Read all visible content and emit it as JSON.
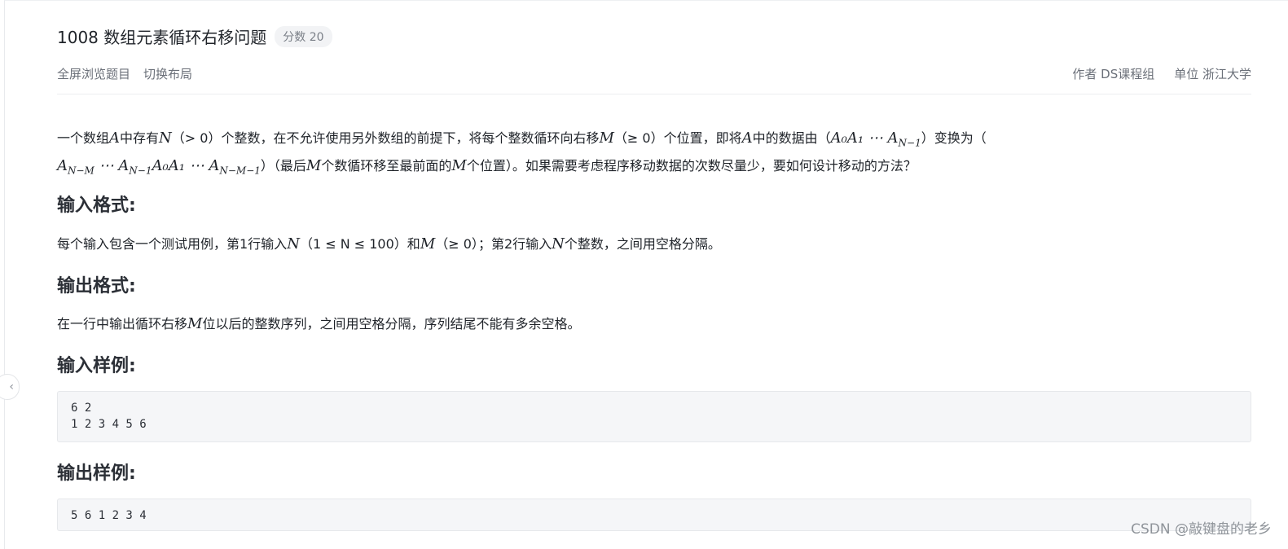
{
  "problem": {
    "title": "1008 数组元素循环右移问题",
    "score": "分数 20",
    "actions": [
      "全屏浏览题目",
      "切换布局"
    ],
    "author": "作者 DS课程组",
    "unit": "单位 浙江大学"
  },
  "description": {
    "line1_a": "一个数组",
    "var_A": "A",
    "line1_b": "中存有",
    "var_N": "N",
    "cond_N": "（> 0）",
    "line1_c": "个整数，在不允许使用另外数组的前提下，将每个整数循环向右移",
    "var_M": "M",
    "cond_M": "（≥ 0）",
    "line1_d": "个位置，即将",
    "line1_e": "中的数据由（",
    "seq_from": "A₀A₁ ⋯ A",
    "seq_from_sub": "N−1",
    "line1_f": "）变换为（",
    "seq_to_a": "A",
    "seq_to_a_sub": "N−M",
    "seq_to_b": " ⋯ A",
    "seq_to_b_sub": "N−1",
    "seq_to_c": "A₀A₁ ⋯ A",
    "seq_to_c_sub": "N−M−1",
    "line2_a": "）（最后",
    "line2_b": "个数循环移至最前面的",
    "line2_c": "个位置）。如果需要考虑程序移动数据的次数尽量少，要如何设计移动的方法？"
  },
  "input_format": {
    "heading": "输入格式:",
    "a": "每个输入包含一个测试用例，第1行输入",
    "range": "（1 ≤ N ≤ 100）",
    "b": "和",
    "mcond": "（≥ 0）",
    "c": "；第2行输入",
    "d": "个整数，之间用空格分隔。"
  },
  "output_format": {
    "heading": "输出格式:",
    "a": "在一行中输出循环右移",
    "b": "位以后的整数序列，之间用空格分隔，序列结尾不能有多余空格。"
  },
  "sample_input": {
    "heading": "输入样例:",
    "code": "6 2\n1 2 3 4 5 6"
  },
  "sample_output": {
    "heading": "输出样例:",
    "code": "5 6 1 2 3 4"
  },
  "watermark": "CSDN @敲键盘的老乡"
}
